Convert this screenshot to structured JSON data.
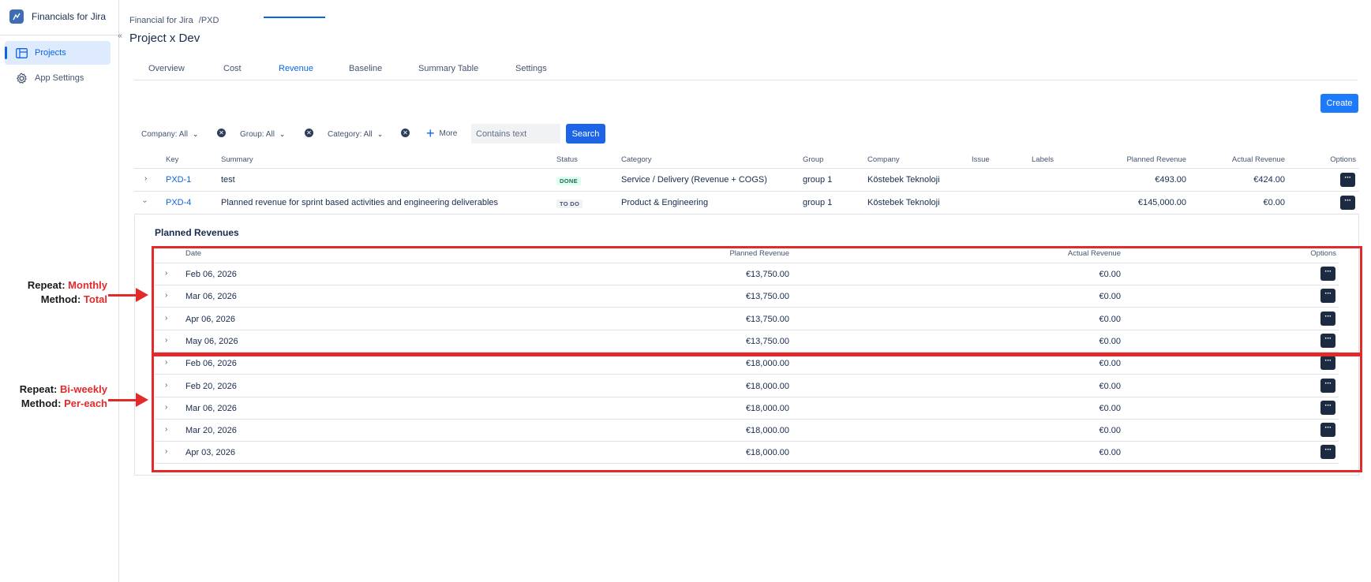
{
  "app": {
    "title": "Financials for Jira"
  },
  "sidebar": {
    "collapse_glyph": "«",
    "items": [
      {
        "label": "Projects",
        "icon": "board-icon",
        "active": true
      },
      {
        "label": "App Settings",
        "icon": "gear-icon",
        "active": false
      }
    ]
  },
  "breadcrumb": {
    "root": "Financial for Jira",
    "separator": "/",
    "project": "PXD"
  },
  "page_title": "Project x Dev",
  "tabs": [
    {
      "label": "Overview"
    },
    {
      "label": "Cost"
    },
    {
      "label": "Revenue",
      "active": true
    },
    {
      "label": "Baseline"
    },
    {
      "label": "Summary Table"
    },
    {
      "label": "Settings"
    }
  ],
  "toolbar": {
    "create_label": "Create"
  },
  "filters": {
    "company": "Company: All",
    "group": "Group: All",
    "category": "Category: All",
    "more_label": "More",
    "search_placeholder": "Contains text",
    "search_label": "Search"
  },
  "table": {
    "columns": [
      "Key",
      "Summary",
      "Status",
      "Category",
      "Group",
      "Company",
      "Issue",
      "Labels",
      "Planned Revenue",
      "Actual Revenue",
      "Options"
    ],
    "rows": [
      {
        "key": "PXD-1",
        "summary": "test",
        "status": "DONE",
        "category": "Service / Delivery (Revenue + COGS)",
        "group": "group 1",
        "company": "Köstebek Teknoloji",
        "issue": "",
        "labels": "",
        "planned": "€493.00",
        "actual": "€424.00",
        "expanded": false
      },
      {
        "key": "PXD-4",
        "summary": "Planned revenue for sprint based activities and engineering deliverables",
        "status": "TO DO",
        "category": "Product & Engineering",
        "group": "group 1",
        "company": "Köstebek Teknoloji",
        "issue": "",
        "labels": "",
        "planned": "€145,000.00",
        "actual": "€0.00",
        "expanded": true
      }
    ]
  },
  "planned_revenues": {
    "title": "Planned Revenues",
    "columns": [
      "Date",
      "Planned Revenue",
      "Actual Revenue",
      "Options"
    ],
    "rows": [
      {
        "date": "Feb 06, 2026",
        "planned": "€13,750.00",
        "actual": "€0.00"
      },
      {
        "date": "Mar 06, 2026",
        "planned": "€13,750.00",
        "actual": "€0.00"
      },
      {
        "date": "Apr 06, 2026",
        "planned": "€13,750.00",
        "actual": "€0.00"
      },
      {
        "date": "May 06, 2026",
        "planned": "€13,750.00",
        "actual": "€0.00"
      },
      {
        "date": "Feb 06, 2026",
        "planned": "€18,000.00",
        "actual": "€0.00"
      },
      {
        "date": "Feb 20, 2026",
        "planned": "€18,000.00",
        "actual": "€0.00"
      },
      {
        "date": "Mar 06, 2026",
        "planned": "€18,000.00",
        "actual": "€0.00"
      },
      {
        "date": "Mar 20, 2026",
        "planned": "€18,000.00",
        "actual": "€0.00"
      },
      {
        "date": "Apr 03, 2026",
        "planned": "€18,000.00",
        "actual": "€0.00"
      }
    ]
  },
  "annotations": [
    {
      "repeat_label": "Repeat:",
      "repeat_value": "Monthly",
      "method_label": "Method:",
      "method_value": "Total"
    },
    {
      "repeat_label": "Repeat:",
      "repeat_value": "Bi-weekly",
      "method_label": "Method:",
      "method_value": "Per-each"
    }
  ],
  "colors": {
    "accent": "#0c66e4",
    "annotation_red": "#e32a2a",
    "options_button": "#1c2b41"
  }
}
